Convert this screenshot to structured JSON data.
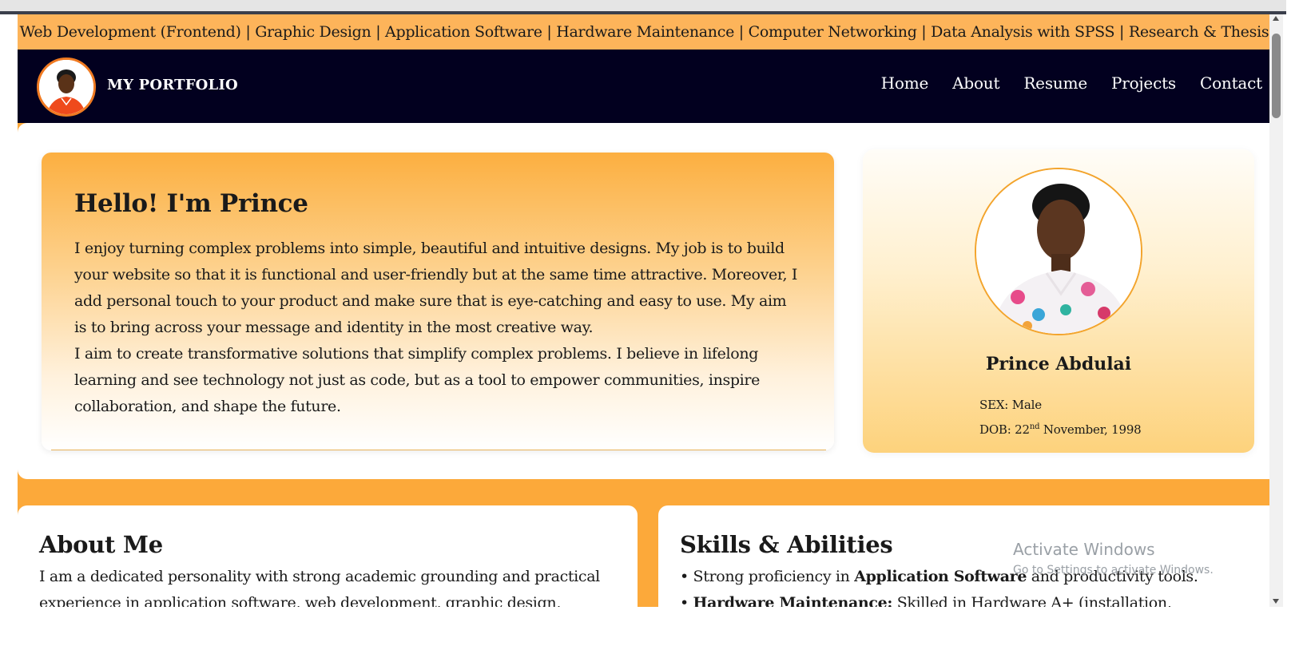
{
  "ticker": {
    "text": "• Web Development (Frontend) | Graphic Design | Application Software | Hardware Maintenance | Computer Networking | Data Analysis with SPSS | Research & Thesis Writing"
  },
  "navbar": {
    "brand": "MY PORTFOLIO",
    "links": [
      "Home",
      "About",
      "Resume",
      "Projects",
      "Contact"
    ]
  },
  "hero": {
    "title": "Hello! I'm Prince",
    "paragraph1": "I enjoy turning complex problems into simple, beautiful and intuitive designs. My job is to build your website so that it is functional and user-friendly but at the same time attractive. Moreover, I add personal touch to your product and make sure that is eye-catching and easy to use. My aim is to bring across your message and identity in the most creative way.",
    "paragraph2": "I aim to create transformative solutions that simplify complex problems. I believe in lifelong learning and see technology not just as code, but as a tool to empower communities, inspire collaboration, and shape the future."
  },
  "profile": {
    "name": "Prince Abdulai",
    "sex": "SEX: Male",
    "dob_prefix": "DOB: 22",
    "dob_sup": "nd",
    "dob_suffix": " November, 1998"
  },
  "about": {
    "title": "About Me",
    "text": "I am a dedicated personality with strong academic grounding and practical experience in application software, web development, graphic design,"
  },
  "skills": {
    "title": "Skills & Abilities",
    "item1_prefix": "• Strong proficiency in ",
    "item1_bold": "Application Software",
    "item1_suffix": " and productivity tools.",
    "item2_bold": "Hardware Maintenance:",
    "item2_suffix": " Skilled in Hardware A+ (installation,"
  },
  "watermark": {
    "line1": "Activate Windows",
    "line2": "Go to Settings to activate Windows."
  },
  "colors": {
    "orange": "#fca93a",
    "navy": "#02001f",
    "accent": "#f07a21"
  }
}
